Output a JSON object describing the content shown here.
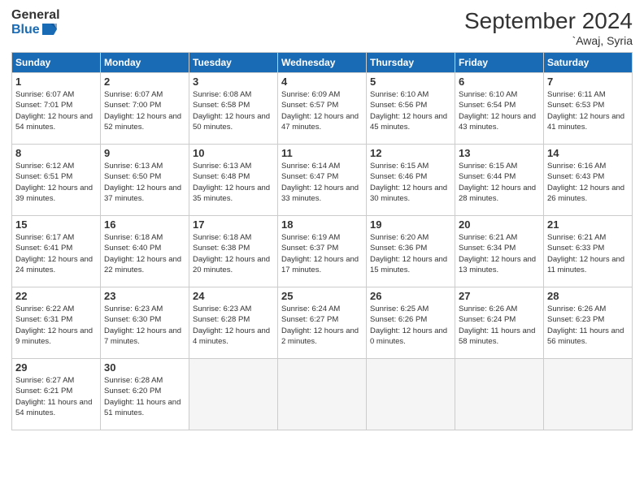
{
  "header": {
    "logo_general": "General",
    "logo_blue": "Blue",
    "month": "September 2024",
    "location": "`Awaj, Syria"
  },
  "weekdays": [
    "Sunday",
    "Monday",
    "Tuesday",
    "Wednesday",
    "Thursday",
    "Friday",
    "Saturday"
  ],
  "weeks": [
    [
      {
        "day": 1,
        "sunrise": "6:07 AM",
        "sunset": "7:01 PM",
        "daylight": "12 hours and 54 minutes."
      },
      {
        "day": 2,
        "sunrise": "6:07 AM",
        "sunset": "7:00 PM",
        "daylight": "12 hours and 52 minutes."
      },
      {
        "day": 3,
        "sunrise": "6:08 AM",
        "sunset": "6:58 PM",
        "daylight": "12 hours and 50 minutes."
      },
      {
        "day": 4,
        "sunrise": "6:09 AM",
        "sunset": "6:57 PM",
        "daylight": "12 hours and 47 minutes."
      },
      {
        "day": 5,
        "sunrise": "6:10 AM",
        "sunset": "6:56 PM",
        "daylight": "12 hours and 45 minutes."
      },
      {
        "day": 6,
        "sunrise": "6:10 AM",
        "sunset": "6:54 PM",
        "daylight": "12 hours and 43 minutes."
      },
      {
        "day": 7,
        "sunrise": "6:11 AM",
        "sunset": "6:53 PM",
        "daylight": "12 hours and 41 minutes."
      }
    ],
    [
      {
        "day": 8,
        "sunrise": "6:12 AM",
        "sunset": "6:51 PM",
        "daylight": "12 hours and 39 minutes."
      },
      {
        "day": 9,
        "sunrise": "6:13 AM",
        "sunset": "6:50 PM",
        "daylight": "12 hours and 37 minutes."
      },
      {
        "day": 10,
        "sunrise": "6:13 AM",
        "sunset": "6:48 PM",
        "daylight": "12 hours and 35 minutes."
      },
      {
        "day": 11,
        "sunrise": "6:14 AM",
        "sunset": "6:47 PM",
        "daylight": "12 hours and 33 minutes."
      },
      {
        "day": 12,
        "sunrise": "6:15 AM",
        "sunset": "6:46 PM",
        "daylight": "12 hours and 30 minutes."
      },
      {
        "day": 13,
        "sunrise": "6:15 AM",
        "sunset": "6:44 PM",
        "daylight": "12 hours and 28 minutes."
      },
      {
        "day": 14,
        "sunrise": "6:16 AM",
        "sunset": "6:43 PM",
        "daylight": "12 hours and 26 minutes."
      }
    ],
    [
      {
        "day": 15,
        "sunrise": "6:17 AM",
        "sunset": "6:41 PM",
        "daylight": "12 hours and 24 minutes."
      },
      {
        "day": 16,
        "sunrise": "6:18 AM",
        "sunset": "6:40 PM",
        "daylight": "12 hours and 22 minutes."
      },
      {
        "day": 17,
        "sunrise": "6:18 AM",
        "sunset": "6:38 PM",
        "daylight": "12 hours and 20 minutes."
      },
      {
        "day": 18,
        "sunrise": "6:19 AM",
        "sunset": "6:37 PM",
        "daylight": "12 hours and 17 minutes."
      },
      {
        "day": 19,
        "sunrise": "6:20 AM",
        "sunset": "6:36 PM",
        "daylight": "12 hours and 15 minutes."
      },
      {
        "day": 20,
        "sunrise": "6:21 AM",
        "sunset": "6:34 PM",
        "daylight": "12 hours and 13 minutes."
      },
      {
        "day": 21,
        "sunrise": "6:21 AM",
        "sunset": "6:33 PM",
        "daylight": "12 hours and 11 minutes."
      }
    ],
    [
      {
        "day": 22,
        "sunrise": "6:22 AM",
        "sunset": "6:31 PM",
        "daylight": "12 hours and 9 minutes."
      },
      {
        "day": 23,
        "sunrise": "6:23 AM",
        "sunset": "6:30 PM",
        "daylight": "12 hours and 7 minutes."
      },
      {
        "day": 24,
        "sunrise": "6:23 AM",
        "sunset": "6:28 PM",
        "daylight": "12 hours and 4 minutes."
      },
      {
        "day": 25,
        "sunrise": "6:24 AM",
        "sunset": "6:27 PM",
        "daylight": "12 hours and 2 minutes."
      },
      {
        "day": 26,
        "sunrise": "6:25 AM",
        "sunset": "6:26 PM",
        "daylight": "12 hours and 0 minutes."
      },
      {
        "day": 27,
        "sunrise": "6:26 AM",
        "sunset": "6:24 PM",
        "daylight": "11 hours and 58 minutes."
      },
      {
        "day": 28,
        "sunrise": "6:26 AM",
        "sunset": "6:23 PM",
        "daylight": "11 hours and 56 minutes."
      }
    ],
    [
      {
        "day": 29,
        "sunrise": "6:27 AM",
        "sunset": "6:21 PM",
        "daylight": "11 hours and 54 minutes."
      },
      {
        "day": 30,
        "sunrise": "6:28 AM",
        "sunset": "6:20 PM",
        "daylight": "11 hours and 51 minutes."
      },
      null,
      null,
      null,
      null,
      null
    ]
  ],
  "labels": {
    "sunrise": "Sunrise:",
    "sunset": "Sunset:",
    "daylight": "Daylight:"
  }
}
